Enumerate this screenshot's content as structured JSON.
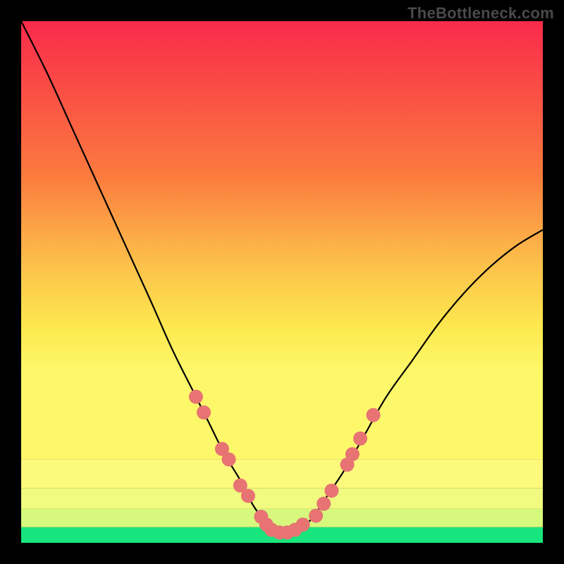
{
  "watermark": "TheBottleneck.com",
  "chart_data": {
    "type": "line",
    "title": "",
    "xlabel": "",
    "ylabel": "",
    "xlim": [
      0,
      100
    ],
    "ylim": [
      0,
      100
    ],
    "background_bands": [
      {
        "y0": 0,
        "y1": 3,
        "color": "#18e57d"
      },
      {
        "y0": 3,
        "y1": 6.5,
        "color": "#d6f97d"
      },
      {
        "y0": 6.5,
        "y1": 10.5,
        "color": "#f0fb7f"
      },
      {
        "y0": 10.5,
        "y1": 16,
        "color": "#fcf97d"
      }
    ],
    "gradient_stops": [
      {
        "offset": 0,
        "color": "#fa2a4b"
      },
      {
        "offset": 35,
        "color": "#fb7a3e"
      },
      {
        "offset": 55,
        "color": "#fcbf4a"
      },
      {
        "offset": 70,
        "color": "#fde94f"
      },
      {
        "offset": 80,
        "color": "#fdf86a"
      }
    ],
    "series": [
      {
        "name": "bottleneck-curve",
        "x": [
          0,
          5,
          10,
          15,
          20,
          25,
          29,
          33,
          36,
          39,
          42,
          44,
          46,
          48,
          50,
          52,
          54,
          56,
          58,
          62,
          66,
          70,
          75,
          80,
          85,
          90,
          95,
          100
        ],
        "y": [
          100,
          90,
          79,
          68,
          57,
          46,
          37,
          29,
          23,
          17,
          12,
          8,
          5,
          3,
          2,
          2,
          3,
          5,
          8,
          14,
          21,
          28,
          35,
          42,
          48,
          53,
          57,
          60
        ]
      }
    ],
    "scatter": [
      {
        "name": "marker",
        "x": 33.5,
        "y": 28
      },
      {
        "name": "marker",
        "x": 35.0,
        "y": 25
      },
      {
        "name": "marker",
        "x": 38.5,
        "y": 18
      },
      {
        "name": "marker",
        "x": 39.8,
        "y": 16
      },
      {
        "name": "marker",
        "x": 42.0,
        "y": 11
      },
      {
        "name": "marker",
        "x": 43.5,
        "y": 9
      },
      {
        "name": "marker",
        "x": 46.0,
        "y": 5
      },
      {
        "name": "marker",
        "x": 47.0,
        "y": 3.5
      },
      {
        "name": "marker",
        "x": 48.0,
        "y": 2.5
      },
      {
        "name": "marker",
        "x": 49.5,
        "y": 2
      },
      {
        "name": "marker",
        "x": 51.0,
        "y": 2
      },
      {
        "name": "marker",
        "x": 52.5,
        "y": 2.5
      },
      {
        "name": "marker",
        "x": 54.0,
        "y": 3.5
      },
      {
        "name": "marker",
        "x": 56.5,
        "y": 5.2
      },
      {
        "name": "marker",
        "x": 58.0,
        "y": 7.5
      },
      {
        "name": "marker",
        "x": 59.5,
        "y": 10
      },
      {
        "name": "marker",
        "x": 62.5,
        "y": 15
      },
      {
        "name": "marker",
        "x": 63.5,
        "y": 17
      },
      {
        "name": "marker",
        "x": 65.0,
        "y": 20
      },
      {
        "name": "marker",
        "x": 67.5,
        "y": 24.5
      }
    ],
    "curve_color": "#000000",
    "marker_color": "#e77373",
    "marker_radius": 10
  }
}
